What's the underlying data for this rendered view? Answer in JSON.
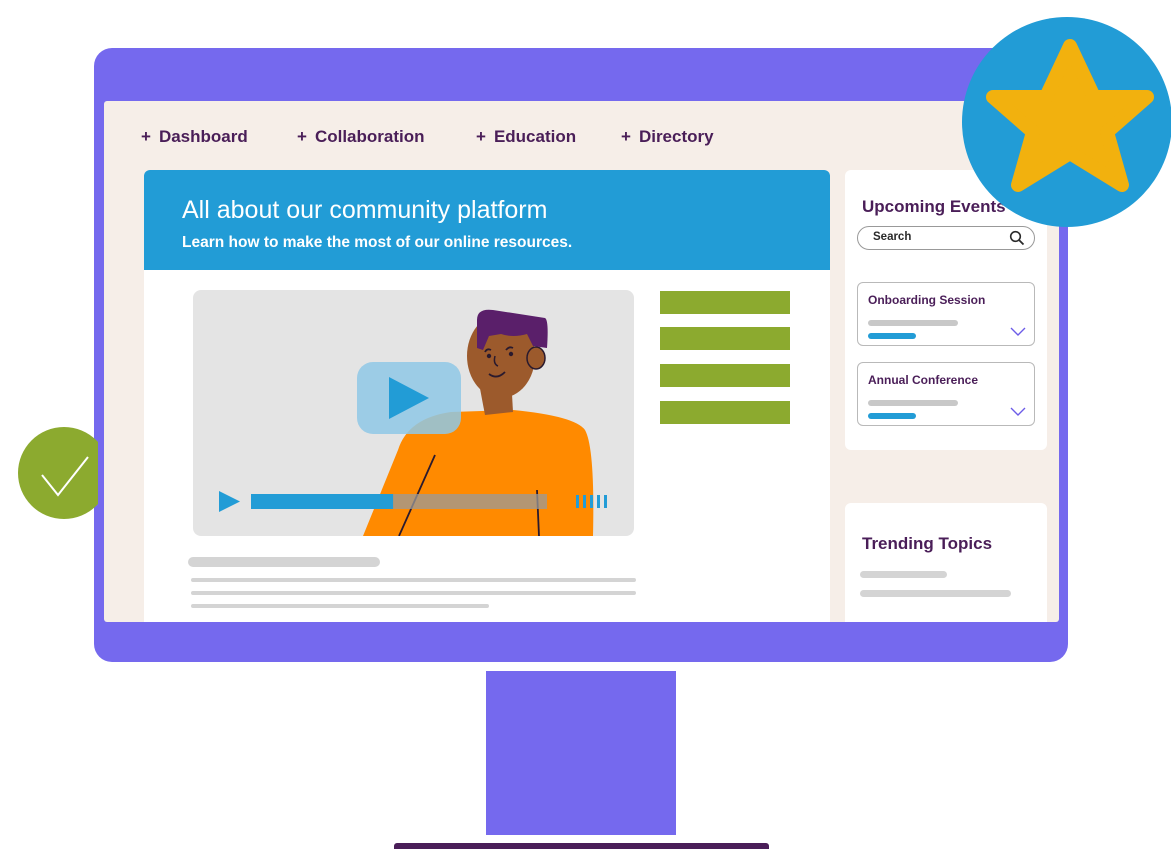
{
  "nav": {
    "items": [
      {
        "plus": "+",
        "label": "Dashboard"
      },
      {
        "plus": "+",
        "label": "Collaboration"
      },
      {
        "plus": "+",
        "label": "Education"
      },
      {
        "plus": "+",
        "label": "Directory"
      }
    ]
  },
  "banner": {
    "title": "All about our community platform",
    "subtitle": "Learn how to make the most of our online resources."
  },
  "video": {
    "progress": 0.48
  },
  "sidebar": {
    "events": {
      "title": "Upcoming Events",
      "search_placeholder": "Search",
      "items": [
        {
          "label": "Onboarding Session"
        },
        {
          "label": "Annual Conference"
        }
      ]
    },
    "topics": {
      "title": "Trending Topics"
    }
  },
  "colors": {
    "frame": "#7569EE",
    "accent_blue": "#229CD6",
    "text_purple": "#4A1E58",
    "green": "#8CAA2F",
    "star": "#F2B10E",
    "orange": "#FF8A00"
  },
  "icons": {
    "star_badge": "star-icon",
    "check_badge": "checkmark-icon",
    "search": "search-icon",
    "expand": "chevron-down-icon",
    "play": "play-icon"
  }
}
